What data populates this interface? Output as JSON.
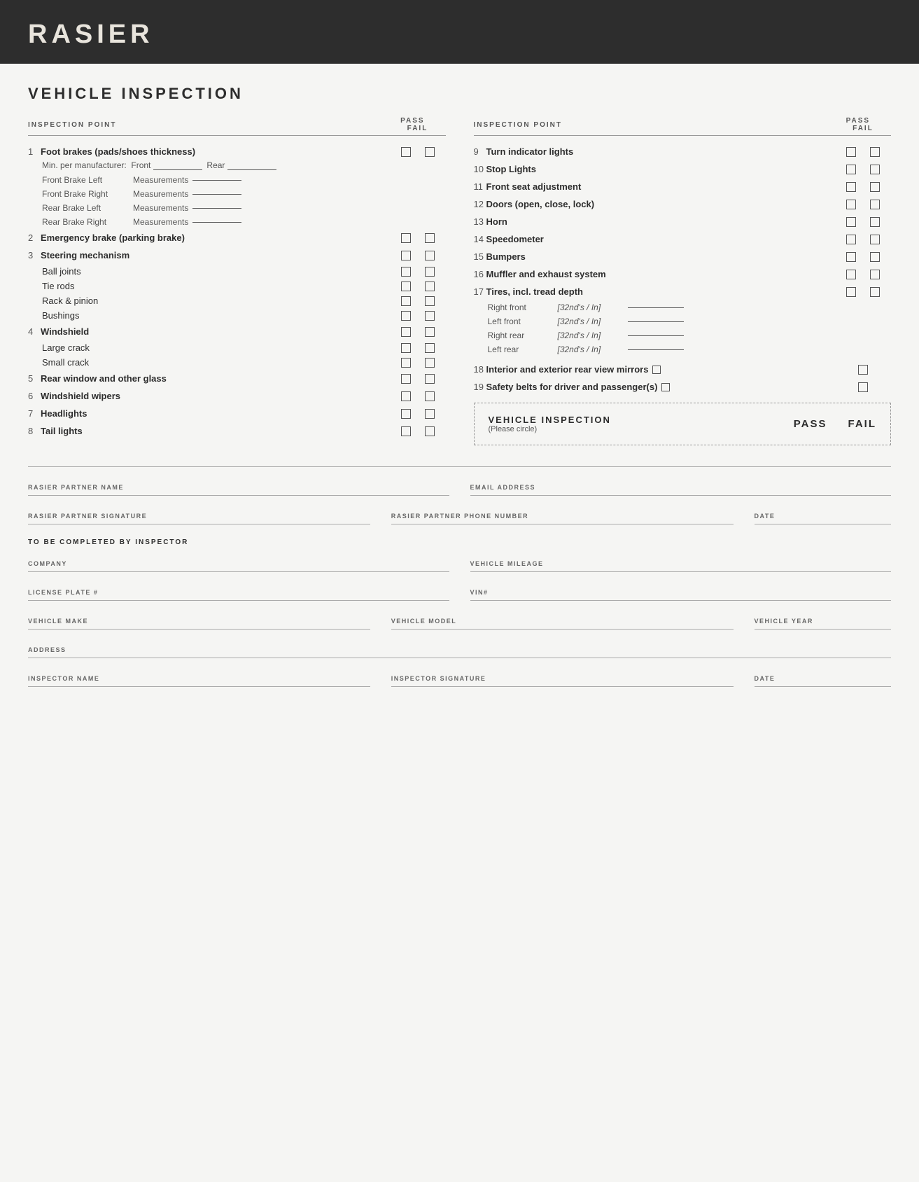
{
  "header": {
    "title": "RASIER"
  },
  "page": {
    "section_title": "VEHICLE INSPECTION",
    "col_headers": {
      "left": {
        "point": "INSPECTION POINT",
        "pass": "PASS",
        "fail": "FAIL"
      },
      "right": {
        "point": "INSPECTION POINT",
        "pass": "PASS",
        "fail": "FAIL"
      }
    }
  },
  "left_items": [
    {
      "num": "1",
      "label": "Foot brakes (pads/shoes thickness)",
      "bold": true,
      "has_checkbox": true
    },
    {
      "num": "",
      "label": "Min. per manufacturer:  Front ______   Rear ______",
      "bold": false,
      "has_checkbox": false,
      "indent": true
    },
    {
      "num": "",
      "label": "Front Brake Left",
      "meas": "Measurements ________",
      "bold": false,
      "has_checkbox": false,
      "indent": true,
      "type": "meas"
    },
    {
      "num": "",
      "label": "Front Brake Right",
      "meas": "Measurements ________",
      "bold": false,
      "has_checkbox": false,
      "indent": true,
      "type": "meas"
    },
    {
      "num": "",
      "label": "Rear Brake Left",
      "meas": "Measurements ________",
      "bold": false,
      "has_checkbox": false,
      "indent": true,
      "type": "meas"
    },
    {
      "num": "",
      "label": "Rear Brake Right",
      "meas": "Measurements ________",
      "bold": false,
      "has_checkbox": false,
      "indent": true,
      "type": "meas"
    },
    {
      "num": "2",
      "label": "Emergency brake (parking brake)",
      "bold": true,
      "has_checkbox": true
    },
    {
      "num": "3",
      "label": "Steering mechanism",
      "bold": true,
      "has_checkbox": true
    },
    {
      "num": "",
      "label": "Ball joints",
      "bold": false,
      "has_checkbox": true,
      "indent": true
    },
    {
      "num": "",
      "label": "Tie rods",
      "bold": false,
      "has_checkbox": true,
      "indent": true
    },
    {
      "num": "",
      "label": "Rack & pinion",
      "bold": false,
      "has_checkbox": true,
      "indent": true
    },
    {
      "num": "",
      "label": "Bushings",
      "bold": false,
      "has_checkbox": true,
      "indent": true
    },
    {
      "num": "4",
      "label": "Windshield",
      "bold": true,
      "has_checkbox": true
    },
    {
      "num": "",
      "label": "Large crack",
      "bold": false,
      "has_checkbox": true,
      "indent": true
    },
    {
      "num": "",
      "label": "Small crack",
      "bold": false,
      "has_checkbox": true,
      "indent": true
    },
    {
      "num": "5",
      "label": "Rear window and other glass",
      "bold": true,
      "has_checkbox": true
    },
    {
      "num": "6",
      "label": "Windshield wipers",
      "bold": true,
      "has_checkbox": true
    },
    {
      "num": "7",
      "label": "Headlights",
      "bold": true,
      "has_checkbox": true
    },
    {
      "num": "8",
      "label": "Tail lights",
      "bold": true,
      "has_checkbox": true
    }
  ],
  "right_items": [
    {
      "num": "9",
      "label": "Turn indicator lights",
      "bold": true,
      "has_checkbox": true
    },
    {
      "num": "10",
      "label": "Stop Lights",
      "bold": true,
      "has_checkbox": true
    },
    {
      "num": "11",
      "label": "Front seat adjustment",
      "bold": true,
      "has_checkbox": true
    },
    {
      "num": "12",
      "label": "Doors (open, close, lock)",
      "bold": true,
      "has_checkbox": true
    },
    {
      "num": "13",
      "label": "Horn",
      "bold": true,
      "has_checkbox": true
    },
    {
      "num": "14",
      "label": "Speedometer",
      "bold": true,
      "has_checkbox": true
    },
    {
      "num": "15",
      "label": "Bumpers",
      "bold": true,
      "has_checkbox": true
    },
    {
      "num": "16",
      "label": "Muffler and exhaust system",
      "bold": true,
      "has_checkbox": true
    },
    {
      "num": "17",
      "label": "Tires, incl. tread depth",
      "bold": true,
      "has_checkbox": true
    },
    {
      "tires": true
    }
  ],
  "tires": [
    {
      "label": "Right front",
      "unit": "[32nd's / In]"
    },
    {
      "label": "Left front",
      "unit": "[32nd's / In]"
    },
    {
      "label": "Right rear",
      "unit": "[32nd's / In]"
    },
    {
      "label": "Left rear",
      "unit": "[32nd's / In]"
    }
  ],
  "right_items_2": [
    {
      "num": "18",
      "label": "Interior and exterior rear view mirrors",
      "bold": true,
      "has_checkbox": true,
      "inline_check": true
    },
    {
      "num": "19",
      "label": "Safety belts for driver and passenger(s)",
      "bold": true,
      "has_checkbox": true,
      "inline_check": true
    }
  ],
  "final_box": {
    "title": "VEHICLE INSPECTION",
    "subtitle": "(Please circle)",
    "pass_label": "PASS",
    "fail_label": "FAIL"
  },
  "form_fields": {
    "partner_name_label": "RASIER PARTNER NAME",
    "email_label": "EMAIL ADDRESS",
    "partner_sig_label": "RASIER PARTNER SIGNATURE",
    "phone_label": "RASIER PARTNER PHONE NUMBER",
    "date_label": "DATE",
    "inspector_section": "TO BE COMPLETED BY INSPECTOR",
    "company_label": "COMPANY",
    "mileage_label": "VEHICLE MILEAGE",
    "plate_label": "LICENSE PLATE #",
    "vin_label": "VIN#",
    "make_label": "VEHICLE MAKE",
    "model_label": "VEHICLE MODEL",
    "year_label": "VEHICLE YEAR",
    "address_label": "ADDRESS",
    "inspector_name_label": "INSPECTOR NAME",
    "inspector_sig_label": "INSPECTOR SIGNATURE",
    "inspector_date_label": "DATE"
  }
}
